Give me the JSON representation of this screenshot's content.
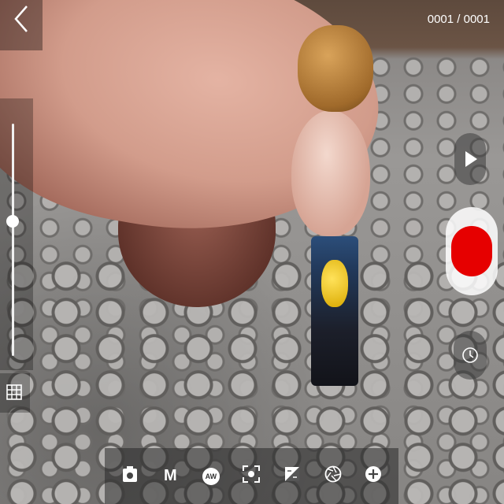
{
  "header": {
    "back_icon": "chevron-left-icon",
    "frame_counter": "0001 / 0001"
  },
  "exposure_slider": {
    "level": 0.58
  },
  "side_controls": {
    "grid_icon": "grid-icon",
    "play_icon": "play-icon",
    "record_color": "#e60000",
    "timer_icon": "clock-icon"
  },
  "toolbar": {
    "items": [
      {
        "icon": "camera-icon"
      },
      {
        "label": "M"
      },
      {
        "label": "AW"
      },
      {
        "icon": "focus-icon"
      },
      {
        "icon": "exposure-icon"
      },
      {
        "icon": "aperture-icon"
      },
      {
        "icon": "add-circle-icon"
      }
    ]
  }
}
